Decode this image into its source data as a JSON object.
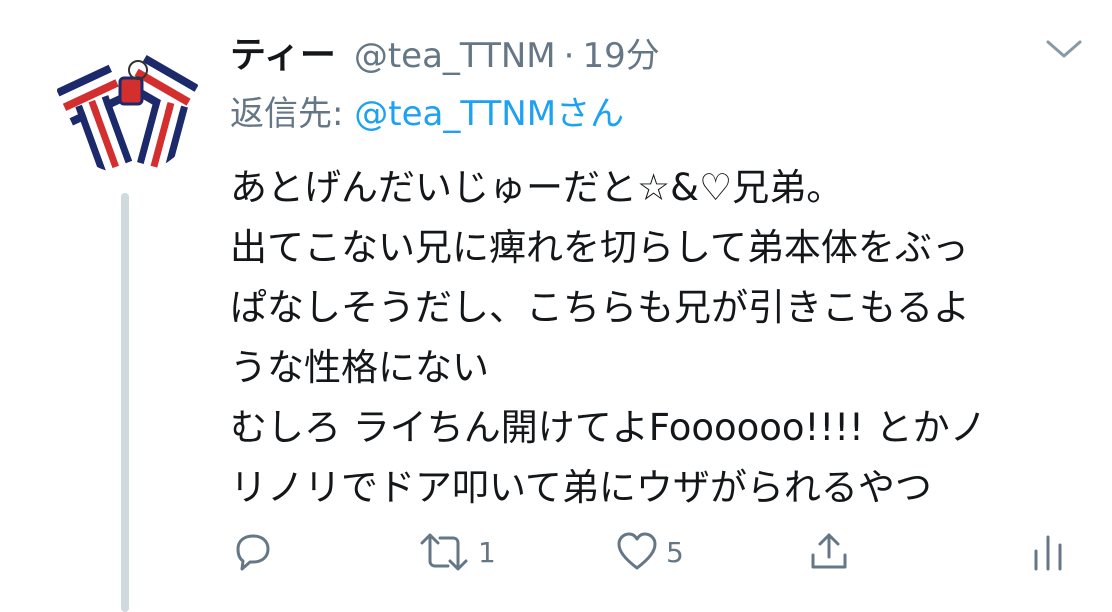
{
  "tweet": {
    "display_name": "ティー",
    "handle": "@tea_TTNM",
    "separator": "·",
    "time": "19分",
    "reply_label": "返信先:",
    "reply_handle": "@tea_TTNMさん",
    "body_lines": [
      "あとげんだいじゅーだと☆&♡兄弟。",
      "出てこない兄に痺れを切らして弟本体をぶっ",
      "ぱなしそうだし、こちらも兄が引きこもるよ",
      "うな性格にない",
      "むしろ ライちん開けてよFoooooo!!!! とかノ",
      "リノリでドア叩いて弟にウザがられるやつ"
    ]
  },
  "actions": {
    "reply_icon": "reply-icon",
    "retweet_icon": "retweet-icon",
    "retweet_count": "1",
    "like_icon": "heart-icon",
    "like_count": "5",
    "share_icon": "share-icon",
    "analytics_icon": "analytics-icon"
  },
  "colors": {
    "text": "#14171a",
    "secondary": "#657786",
    "link": "#1da1f2",
    "thread_line": "#cfd9de"
  }
}
